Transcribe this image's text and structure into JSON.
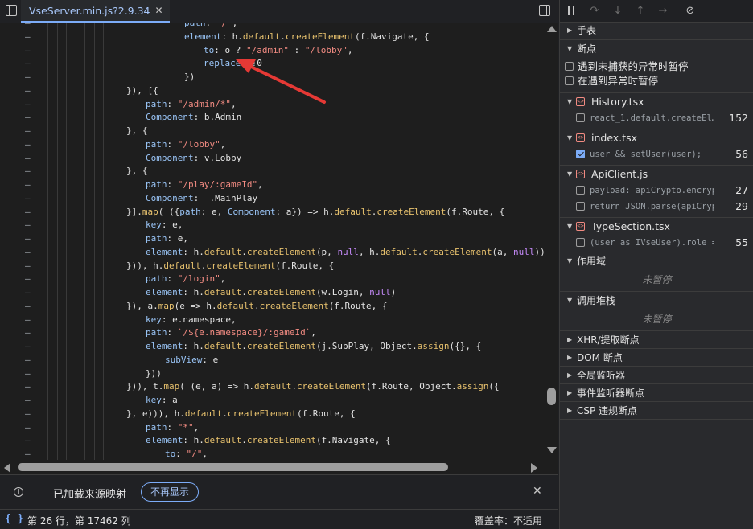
{
  "tab": {
    "title": "VseServer.min.js?2.9.34",
    "close": "✕"
  },
  "code_lines": [
    {
      "text": "path: \"/\","
    },
    {
      "text": "element: h.default.createElement(f.Navigate, {"
    },
    {
      "text": "to: o ? \"/admin\" : \"/lobby\","
    },
    {
      "text": "replace: !0"
    },
    {
      "text": "})"
    },
    {
      "text": "}), [{"
    },
    {
      "text": "path: \"/admin/*\","
    },
    {
      "text": "Component: b.Admin"
    },
    {
      "text": "}, {"
    },
    {
      "text": "path: \"/lobby\","
    },
    {
      "text": "Component: v.Lobby"
    },
    {
      "text": "}, {"
    },
    {
      "text": "path: \"/play/:gameId\","
    },
    {
      "text": "Component: _.MainPlay"
    },
    {
      "text": "}].map( ({path: e, Component: a}) => h.default.createElement(f.Route, {"
    },
    {
      "text": "key: e,"
    },
    {
      "text": "path: e,"
    },
    {
      "text": "element: h.default.createElement(p, null, h.default.createElement(a, null))"
    },
    {
      "text": "})), h.default.createElement(f.Route, {"
    },
    {
      "text": "path: \"/login\","
    },
    {
      "text": "element: h.default.createElement(w.Login, null)"
    },
    {
      "text": "}), a.map(e => h.default.createElement(f.Route, {"
    },
    {
      "text": "key: e.namespace,"
    },
    {
      "text": "path: `/${e.namespace}/:gameId`,"
    },
    {
      "text": "element: h.default.createElement(j.SubPlay, Object.assign({}, {"
    },
    {
      "text": "subView: e"
    },
    {
      "text": "}))"
    },
    {
      "text": "})), t.map( (e, a) => h.default.createElement(f.Route, Object.assign({"
    },
    {
      "text": "key: a"
    },
    {
      "text": "}, e))), h.default.createElement(f.Route, {"
    },
    {
      "text": "path: \"*\","
    },
    {
      "text": "element: h.default.createElement(f.Navigate, {"
    },
    {
      "text": "to: \"/\","
    }
  ],
  "gutter_marker": "–",
  "infobar": {
    "text": "已加载来源映射",
    "button": "不再显示",
    "close": "✕"
  },
  "statusbar": {
    "braces": "{ }",
    "position": "第 26 行，第 17462 列",
    "coverage": "覆盖率：不适用"
  },
  "sidebar": {
    "watch": "手表",
    "breakpoints": "断点",
    "pause_uncaught": "遇到未捕获的异常时暂停",
    "pause_caught": "在遇到异常时暂停",
    "files": [
      {
        "name": "History.tsx",
        "rows": [
          {
            "code": "react_1.default.createEl…",
            "line": "152",
            "checked": false
          }
        ]
      },
      {
        "name": "index.tsx",
        "rows": [
          {
            "code": "user && setUser(user);",
            "line": "56",
            "checked": true
          }
        ]
      },
      {
        "name": "ApiClient.js",
        "rows": [
          {
            "code": "payload: apiCrypto.encrypt…",
            "line": "27",
            "checked": false
          },
          {
            "code": "return JSON.parse(apiCrypt…",
            "line": "29",
            "checked": false
          }
        ]
      },
      {
        "name": "TypeSection.tsx",
        "rows": [
          {
            "code": "(user as IVseUser).role ==…",
            "line": "55",
            "checked": false
          }
        ]
      }
    ],
    "scope": "作用域",
    "not_paused_1": "未暂停",
    "call_stack": "调用堆栈",
    "not_paused_2": "未暂停",
    "xhr": "XHR/提取断点",
    "dom": "DOM 断点",
    "global": "全局监听器",
    "event": "事件监听器断点",
    "csp": "CSP 违规断点"
  },
  "colors": {
    "accent": "#7cacf8",
    "string": "#f28b82",
    "keyword": "#c58af9",
    "arrow": "#e53935"
  }
}
